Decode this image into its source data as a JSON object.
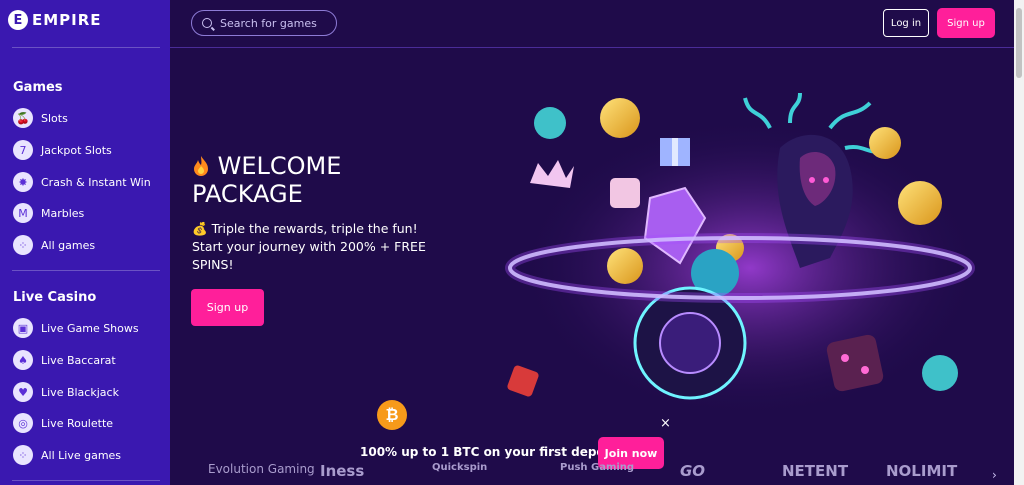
{
  "brand": {
    "logo_mark": "E",
    "name": "EMPIRE"
  },
  "sidebar": {
    "games_title": "Games",
    "games": [
      {
        "label": "Slots",
        "icon": "cherries-icon",
        "glyph": "🍒"
      },
      {
        "label": "Jackpot Slots",
        "icon": "seven-icon",
        "glyph": "7"
      },
      {
        "label": "Crash & Instant Win",
        "icon": "explosion-icon",
        "glyph": "✸"
      },
      {
        "label": "Marbles",
        "icon": "marbles-icon",
        "glyph": "M"
      },
      {
        "label": "All games",
        "icon": "grid-icon",
        "glyph": "⁘"
      }
    ],
    "live_title": "Live Casino",
    "live": [
      {
        "label": "Live Game Shows",
        "icon": "tv-icon",
        "glyph": "▣"
      },
      {
        "label": "Live Baccarat",
        "icon": "cards-icon",
        "glyph": "♠"
      },
      {
        "label": "Live Blackjack",
        "icon": "blackjack-icon",
        "glyph": "♥"
      },
      {
        "label": "Live Roulette",
        "icon": "roulette-icon",
        "glyph": "◎"
      },
      {
        "label": "All Live games",
        "icon": "grid-icon",
        "glyph": "⁘"
      }
    ]
  },
  "header": {
    "search_placeholder": "Search for games",
    "login_label": "Log in",
    "signup_label": "Sign up"
  },
  "hero": {
    "title_line1": "WELCOME",
    "title_line2": "PACKAGE",
    "tagline_emoji": "💰",
    "tagline": "Triple the rewards, triple the fun! Start your journey with 200% + FREE SPINS!",
    "cta": "Sign up"
  },
  "promo": {
    "coin": "₿",
    "text": "100% up to 1 BTC on your first deposit",
    "cta": "Join now",
    "close": "×"
  },
  "providers": [
    "Evolution Gaming",
    "Iness",
    "Quickspin",
    "Push Gaming",
    "GO",
    "NETENT",
    "NOLIMIT"
  ],
  "providers_arrow": "›",
  "colors": {
    "accent": "#ff1f9a",
    "sidebar": "#3a18b0",
    "background": "#1f0b4a"
  }
}
